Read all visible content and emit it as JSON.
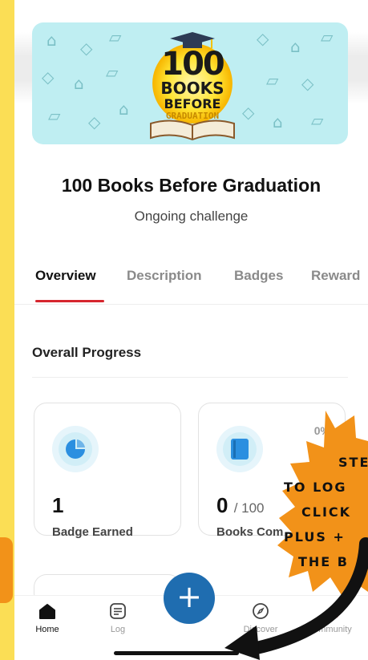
{
  "banner": {
    "logo_number": "100",
    "logo_word1": "BOOKS",
    "logo_word2": "BEFORE",
    "logo_word3": "GRADUATION"
  },
  "challenge": {
    "title": "100 Books Before Graduation",
    "status": "Ongoing challenge"
  },
  "tabs": [
    {
      "label": "Overview",
      "active": true
    },
    {
      "label": "Description",
      "active": false
    },
    {
      "label": "Badges",
      "active": false
    },
    {
      "label": "Reward",
      "active": false
    }
  ],
  "progress": {
    "section_title": "Overall Progress",
    "badges": {
      "value": "1",
      "label": "Badge Earned",
      "icon": "badge-icon"
    },
    "books": {
      "value": "0",
      "total": "/ 100",
      "label": "Books Com",
      "percent": "0%",
      "icon": "book-icon"
    }
  },
  "nav": {
    "home": "Home",
    "log": "Log",
    "add": "+",
    "discover": "Discover",
    "community": "Community"
  },
  "sticker": {
    "lines": [
      "STE",
      "TO LOG",
      "CLICK",
      "PLUS +",
      "THE B"
    ]
  },
  "colors": {
    "background": "#fbde55",
    "accent_red": "#d6262e",
    "fab_blue": "#1f6db0",
    "sticker_orange": "#f29219"
  }
}
